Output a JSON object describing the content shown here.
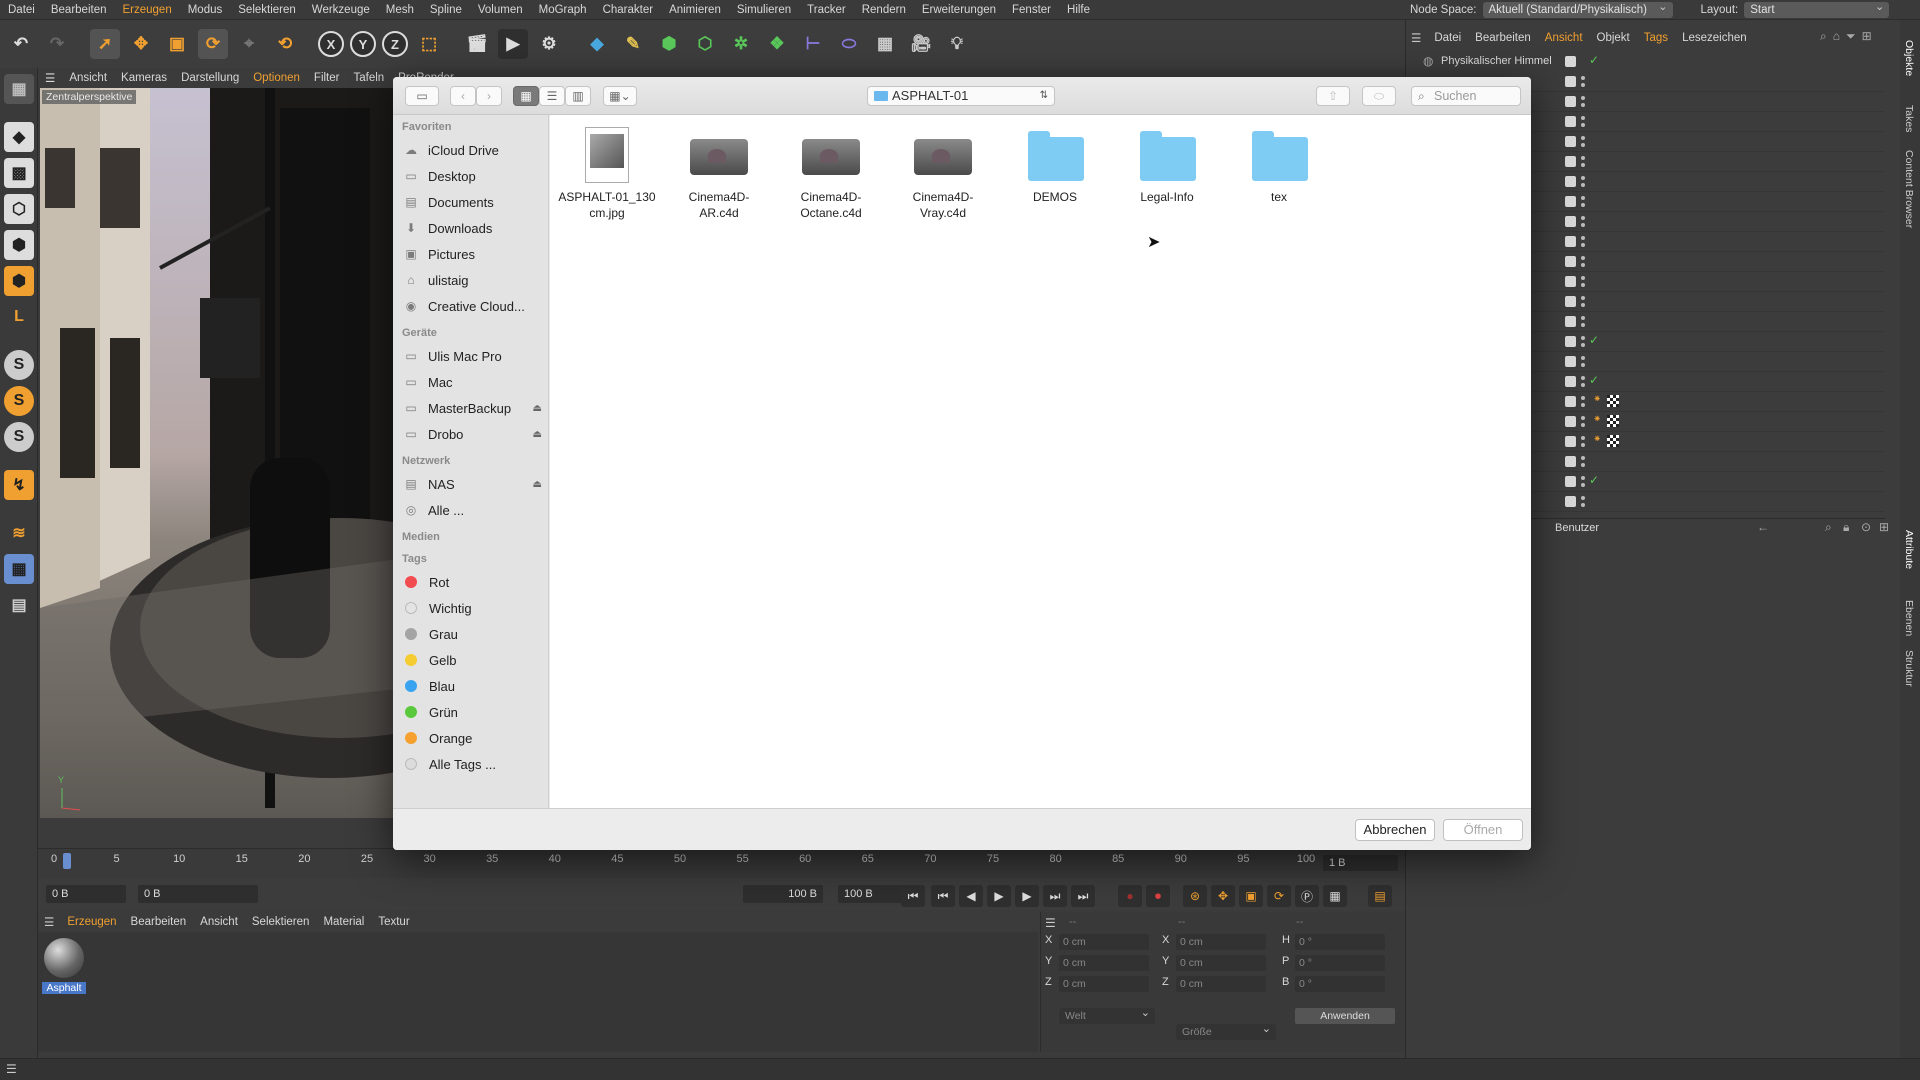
{
  "menubar": {
    "items": [
      "Datei",
      "Bearbeiten",
      "Erzeugen",
      "Modus",
      "Selektieren",
      "Werkzeuge",
      "Mesh",
      "Spline",
      "Volumen",
      "MoGraph",
      "Charakter",
      "Animieren",
      "Simulieren",
      "Tracker",
      "Rendern",
      "Erweiterungen",
      "Fenster",
      "Hilfe"
    ],
    "node_space_label": "Node Space:",
    "node_space_value": "Aktuell (Standard/Physikalisch)",
    "layout_label": "Layout:",
    "layout_value": "Start"
  },
  "viewport": {
    "menu": [
      "Ansicht",
      "Kameras",
      "Darstellung",
      "Optionen",
      "Filter",
      "Tafeln",
      "ProRender"
    ],
    "label": "Zentralperspektive"
  },
  "object_manager": {
    "menu": [
      "Datei",
      "Bearbeiten",
      "Ansicht",
      "Objekt",
      "Tags",
      "Lesezeichen"
    ],
    "first_object": "Physikalischer Himmel",
    "attr_mode": "Benutzer"
  },
  "side_tabs": [
    "Objekte",
    "Takes",
    "Content Browser",
    "Attribute",
    "Ebenen",
    "Struktur"
  ],
  "dialog": {
    "path": "ASPHALT-01",
    "search_placeholder": "Suchen",
    "sections": {
      "favorites": "Favoriten",
      "devices": "Geräte",
      "network": "Netzwerk",
      "media": "Medien",
      "tags": "Tags"
    },
    "favorites": [
      {
        "label": "iCloud Drive",
        "icon": "cloud-icon"
      },
      {
        "label": "Desktop",
        "icon": "desktop-icon"
      },
      {
        "label": "Documents",
        "icon": "documents-icon"
      },
      {
        "label": "Downloads",
        "icon": "downloads-icon"
      },
      {
        "label": "Pictures",
        "icon": "pictures-icon"
      },
      {
        "label": "ulistaig",
        "icon": "home-icon"
      },
      {
        "label": "Creative Cloud...",
        "icon": "creative-cloud-icon"
      }
    ],
    "devices": [
      {
        "label": "Ulis Mac Pro",
        "icon": "computer-icon",
        "eject": false
      },
      {
        "label": "Mac",
        "icon": "drive-icon",
        "eject": false
      },
      {
        "label": "MasterBackup",
        "icon": "drive-icon",
        "eject": true
      },
      {
        "label": "Drobo",
        "icon": "drive-icon",
        "eject": true
      }
    ],
    "network": [
      {
        "label": "NAS",
        "icon": "server-icon",
        "eject": true
      },
      {
        "label": "Alle ...",
        "icon": "globe-icon",
        "eject": false
      }
    ],
    "tags": [
      {
        "label": "Rot",
        "color": "#f24b50"
      },
      {
        "label": "Wichtig",
        "color": "#e4e4e4"
      },
      {
        "label": "Grau",
        "color": "#a4a4a4"
      },
      {
        "label": "Gelb",
        "color": "#f5cc31"
      },
      {
        "label": "Blau",
        "color": "#3aa3f0"
      },
      {
        "label": "Grün",
        "color": "#5ac83c"
      },
      {
        "label": "Orange",
        "color": "#f6a030"
      },
      {
        "label": "Alle Tags ...",
        "color": "#dcdcdc"
      }
    ],
    "files": [
      {
        "line1": "ASPHALT-01_130",
        "line2": "cm.jpg",
        "kind": "jpg"
      },
      {
        "line1": "Cinema4D-",
        "line2": "AR.c4d",
        "kind": "c4d"
      },
      {
        "line1": "Cinema4D-",
        "line2": "Octane.c4d",
        "kind": "c4d"
      },
      {
        "line1": "Cinema4D-",
        "line2": "Vray.c4d",
        "kind": "c4d"
      },
      {
        "line1": "DEMOS",
        "line2": "",
        "kind": "folder"
      },
      {
        "line1": "Legal-Info",
        "line2": "",
        "kind": "folder"
      },
      {
        "line1": "tex",
        "line2": "",
        "kind": "folder"
      }
    ],
    "cancel": "Abbrechen",
    "open": "Öffnen"
  },
  "timeline": {
    "ticks": [
      "0",
      "5",
      "10",
      "15",
      "20",
      "25",
      "30",
      "35",
      "40",
      "45",
      "50",
      "55",
      "60",
      "65",
      "70",
      "75",
      "80",
      "85",
      "90",
      "95",
      "100"
    ],
    "right_field": "1 B",
    "start_field": "0 B",
    "current_field": "0 B",
    "end_field_a": "100 B",
    "end_field_b": "100 B"
  },
  "material_manager": {
    "menu": [
      "Erzeugen",
      "Bearbeiten",
      "Ansicht",
      "Selektieren",
      "Material",
      "Textur"
    ],
    "material_name": "Asphalt"
  },
  "coordinates": {
    "header_a": "--",
    "header_b": "--",
    "header_c": "--",
    "labels_left": [
      "X",
      "Y",
      "Z"
    ],
    "labels_mid": [
      "X",
      "Y",
      "Z"
    ],
    "labels_right": [
      "H",
      "P",
      "B"
    ],
    "value_cm": "0 cm",
    "value_deg": "0 °",
    "mode_a": "Welt",
    "mode_b": "Größe",
    "apply": "Anwenden"
  }
}
